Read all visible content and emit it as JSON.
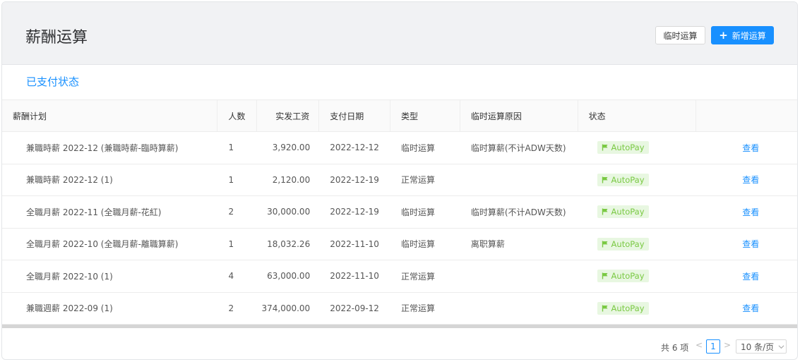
{
  "header": {
    "title": "薪酬运算",
    "temp_button": "临时运算",
    "add_button": "新增运算"
  },
  "section": {
    "title": "已支付状态"
  },
  "table": {
    "columns": [
      "薪酬计划",
      "人数",
      "实发工资",
      "支付日期",
      "类型",
      "临时运算原因",
      "状态",
      ""
    ],
    "rows": [
      {
        "plan": "兼職時薪 2022-12 (兼職時薪-臨時算薪)",
        "count": "1",
        "salary": "3,920.00",
        "date": "2022-12-12",
        "type": "临时运算",
        "reason": "临时算薪(不计ADW天数)",
        "status": "AutoPay",
        "action": "查看"
      },
      {
        "plan": "兼職時薪 2022-12 (1)",
        "count": "1",
        "salary": "2,120.00",
        "date": "2022-12-19",
        "type": "正常运算",
        "reason": "",
        "status": "AutoPay",
        "action": "查看"
      },
      {
        "plan": "全職月薪 2022-11 (全職月薪-花紅)",
        "count": "2",
        "salary": "30,000.00",
        "date": "2022-12-19",
        "type": "临时运算",
        "reason": "临时算薪(不计ADW天数)",
        "status": "AutoPay",
        "action": "查看"
      },
      {
        "plan": "全職月薪 2022-10 (全職月薪-離職算薪)",
        "count": "1",
        "salary": "18,032.26",
        "date": "2022-11-10",
        "type": "临时运算",
        "reason": "离职算薪",
        "status": "AutoPay",
        "action": "查看"
      },
      {
        "plan": "全職月薪 2022-10 (1)",
        "count": "4",
        "salary": "63,000.00",
        "date": "2022-11-10",
        "type": "正常运算",
        "reason": "",
        "status": "AutoPay",
        "action": "查看"
      },
      {
        "plan": "兼職週薪 2022-09 (1)",
        "count": "2",
        "salary": "374,000.00",
        "date": "2022-09-12",
        "type": "正常运算",
        "reason": "",
        "status": "AutoPay",
        "action": "查看"
      }
    ]
  },
  "pagination": {
    "total": "共 6 项",
    "current_page": "1",
    "page_size": "10 条/页"
  },
  "colors": {
    "primary": "#1890ff",
    "badge_bg": "#e8f7e1",
    "badge_text": "#7ac943"
  }
}
